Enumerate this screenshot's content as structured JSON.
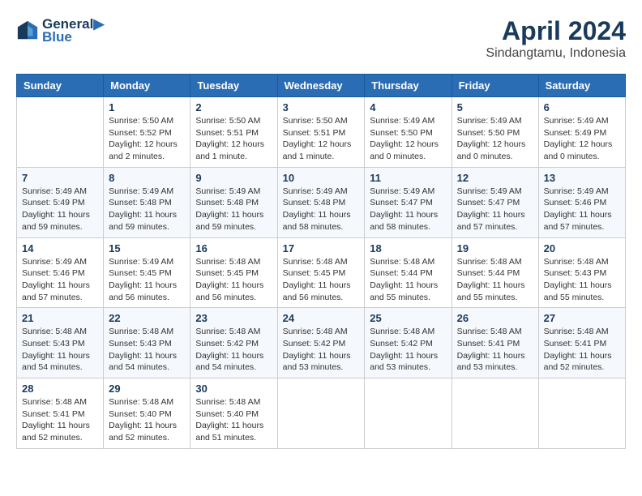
{
  "header": {
    "logo_line1": "General",
    "logo_line2": "Blue",
    "month_title": "April 2024",
    "subtitle": "Sindangtamu, Indonesia"
  },
  "days_of_week": [
    "Sunday",
    "Monday",
    "Tuesday",
    "Wednesday",
    "Thursday",
    "Friday",
    "Saturday"
  ],
  "weeks": [
    [
      {
        "day": "",
        "info": ""
      },
      {
        "day": "1",
        "info": "Sunrise: 5:50 AM\nSunset: 5:52 PM\nDaylight: 12 hours\nand 2 minutes."
      },
      {
        "day": "2",
        "info": "Sunrise: 5:50 AM\nSunset: 5:51 PM\nDaylight: 12 hours\nand 1 minute."
      },
      {
        "day": "3",
        "info": "Sunrise: 5:50 AM\nSunset: 5:51 PM\nDaylight: 12 hours\nand 1 minute."
      },
      {
        "day": "4",
        "info": "Sunrise: 5:49 AM\nSunset: 5:50 PM\nDaylight: 12 hours\nand 0 minutes."
      },
      {
        "day": "5",
        "info": "Sunrise: 5:49 AM\nSunset: 5:50 PM\nDaylight: 12 hours\nand 0 minutes."
      },
      {
        "day": "6",
        "info": "Sunrise: 5:49 AM\nSunset: 5:49 PM\nDaylight: 12 hours\nand 0 minutes."
      }
    ],
    [
      {
        "day": "7",
        "info": "Sunrise: 5:49 AM\nSunset: 5:49 PM\nDaylight: 11 hours\nand 59 minutes."
      },
      {
        "day": "8",
        "info": "Sunrise: 5:49 AM\nSunset: 5:48 PM\nDaylight: 11 hours\nand 59 minutes."
      },
      {
        "day": "9",
        "info": "Sunrise: 5:49 AM\nSunset: 5:48 PM\nDaylight: 11 hours\nand 59 minutes."
      },
      {
        "day": "10",
        "info": "Sunrise: 5:49 AM\nSunset: 5:48 PM\nDaylight: 11 hours\nand 58 minutes."
      },
      {
        "day": "11",
        "info": "Sunrise: 5:49 AM\nSunset: 5:47 PM\nDaylight: 11 hours\nand 58 minutes."
      },
      {
        "day": "12",
        "info": "Sunrise: 5:49 AM\nSunset: 5:47 PM\nDaylight: 11 hours\nand 57 minutes."
      },
      {
        "day": "13",
        "info": "Sunrise: 5:49 AM\nSunset: 5:46 PM\nDaylight: 11 hours\nand 57 minutes."
      }
    ],
    [
      {
        "day": "14",
        "info": "Sunrise: 5:49 AM\nSunset: 5:46 PM\nDaylight: 11 hours\nand 57 minutes."
      },
      {
        "day": "15",
        "info": "Sunrise: 5:49 AM\nSunset: 5:45 PM\nDaylight: 11 hours\nand 56 minutes."
      },
      {
        "day": "16",
        "info": "Sunrise: 5:48 AM\nSunset: 5:45 PM\nDaylight: 11 hours\nand 56 minutes."
      },
      {
        "day": "17",
        "info": "Sunrise: 5:48 AM\nSunset: 5:45 PM\nDaylight: 11 hours\nand 56 minutes."
      },
      {
        "day": "18",
        "info": "Sunrise: 5:48 AM\nSunset: 5:44 PM\nDaylight: 11 hours\nand 55 minutes."
      },
      {
        "day": "19",
        "info": "Sunrise: 5:48 AM\nSunset: 5:44 PM\nDaylight: 11 hours\nand 55 minutes."
      },
      {
        "day": "20",
        "info": "Sunrise: 5:48 AM\nSunset: 5:43 PM\nDaylight: 11 hours\nand 55 minutes."
      }
    ],
    [
      {
        "day": "21",
        "info": "Sunrise: 5:48 AM\nSunset: 5:43 PM\nDaylight: 11 hours\nand 54 minutes."
      },
      {
        "day": "22",
        "info": "Sunrise: 5:48 AM\nSunset: 5:43 PM\nDaylight: 11 hours\nand 54 minutes."
      },
      {
        "day": "23",
        "info": "Sunrise: 5:48 AM\nSunset: 5:42 PM\nDaylight: 11 hours\nand 54 minutes."
      },
      {
        "day": "24",
        "info": "Sunrise: 5:48 AM\nSunset: 5:42 PM\nDaylight: 11 hours\nand 53 minutes."
      },
      {
        "day": "25",
        "info": "Sunrise: 5:48 AM\nSunset: 5:42 PM\nDaylight: 11 hours\nand 53 minutes."
      },
      {
        "day": "26",
        "info": "Sunrise: 5:48 AM\nSunset: 5:41 PM\nDaylight: 11 hours\nand 53 minutes."
      },
      {
        "day": "27",
        "info": "Sunrise: 5:48 AM\nSunset: 5:41 PM\nDaylight: 11 hours\nand 52 minutes."
      }
    ],
    [
      {
        "day": "28",
        "info": "Sunrise: 5:48 AM\nSunset: 5:41 PM\nDaylight: 11 hours\nand 52 minutes."
      },
      {
        "day": "29",
        "info": "Sunrise: 5:48 AM\nSunset: 5:40 PM\nDaylight: 11 hours\nand 52 minutes."
      },
      {
        "day": "30",
        "info": "Sunrise: 5:48 AM\nSunset: 5:40 PM\nDaylight: 11 hours\nand 51 minutes."
      },
      {
        "day": "",
        "info": ""
      },
      {
        "day": "",
        "info": ""
      },
      {
        "day": "",
        "info": ""
      },
      {
        "day": "",
        "info": ""
      }
    ]
  ]
}
